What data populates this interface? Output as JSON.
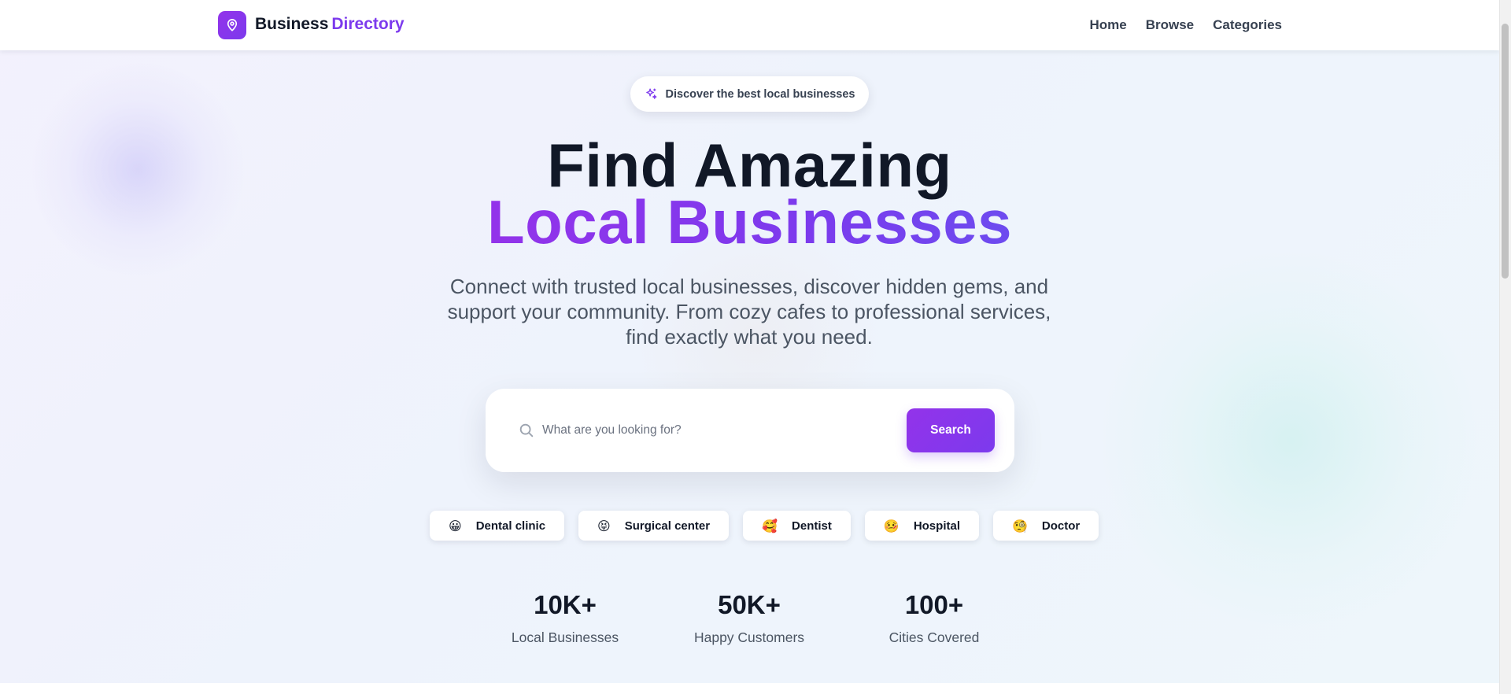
{
  "brand": {
    "name_part1": "Business",
    "name_part2": "Directory",
    "icon": "map-pin-icon"
  },
  "nav": {
    "links": [
      "Home",
      "Browse",
      "Categories"
    ]
  },
  "hero": {
    "badge_text": "Discover the best local businesses",
    "badge_icon": "sparkles-icon",
    "title_line1": "Find Amazing",
    "title_line2": "Local Businesses",
    "subtitle": "Connect with trusted local businesses, discover hidden gems, and support your community. From cozy cafes to professional services, find exactly what you need."
  },
  "search": {
    "placeholder": "What are you looking for?",
    "button_label": "Search",
    "icon": "search-icon"
  },
  "categories": [
    {
      "emoji": "😀",
      "label": "Dental clinic"
    },
    {
      "emoji": "😝",
      "label": "Surgical center"
    },
    {
      "emoji": "🥰",
      "label": "Dentist"
    },
    {
      "emoji": "🤒",
      "label": "Hospital"
    },
    {
      "emoji": "🧐",
      "label": "Doctor"
    }
  ],
  "stats": [
    {
      "value": "10K+",
      "label": "Local Businesses"
    },
    {
      "value": "50K+",
      "label": "Happy Customers"
    },
    {
      "value": "100+",
      "label": "Cities Covered"
    }
  ],
  "colors": {
    "accent": "#7c3aed",
    "accent_light": "#9333ea",
    "text_dark": "#111827",
    "text_muted": "#4b5563"
  }
}
